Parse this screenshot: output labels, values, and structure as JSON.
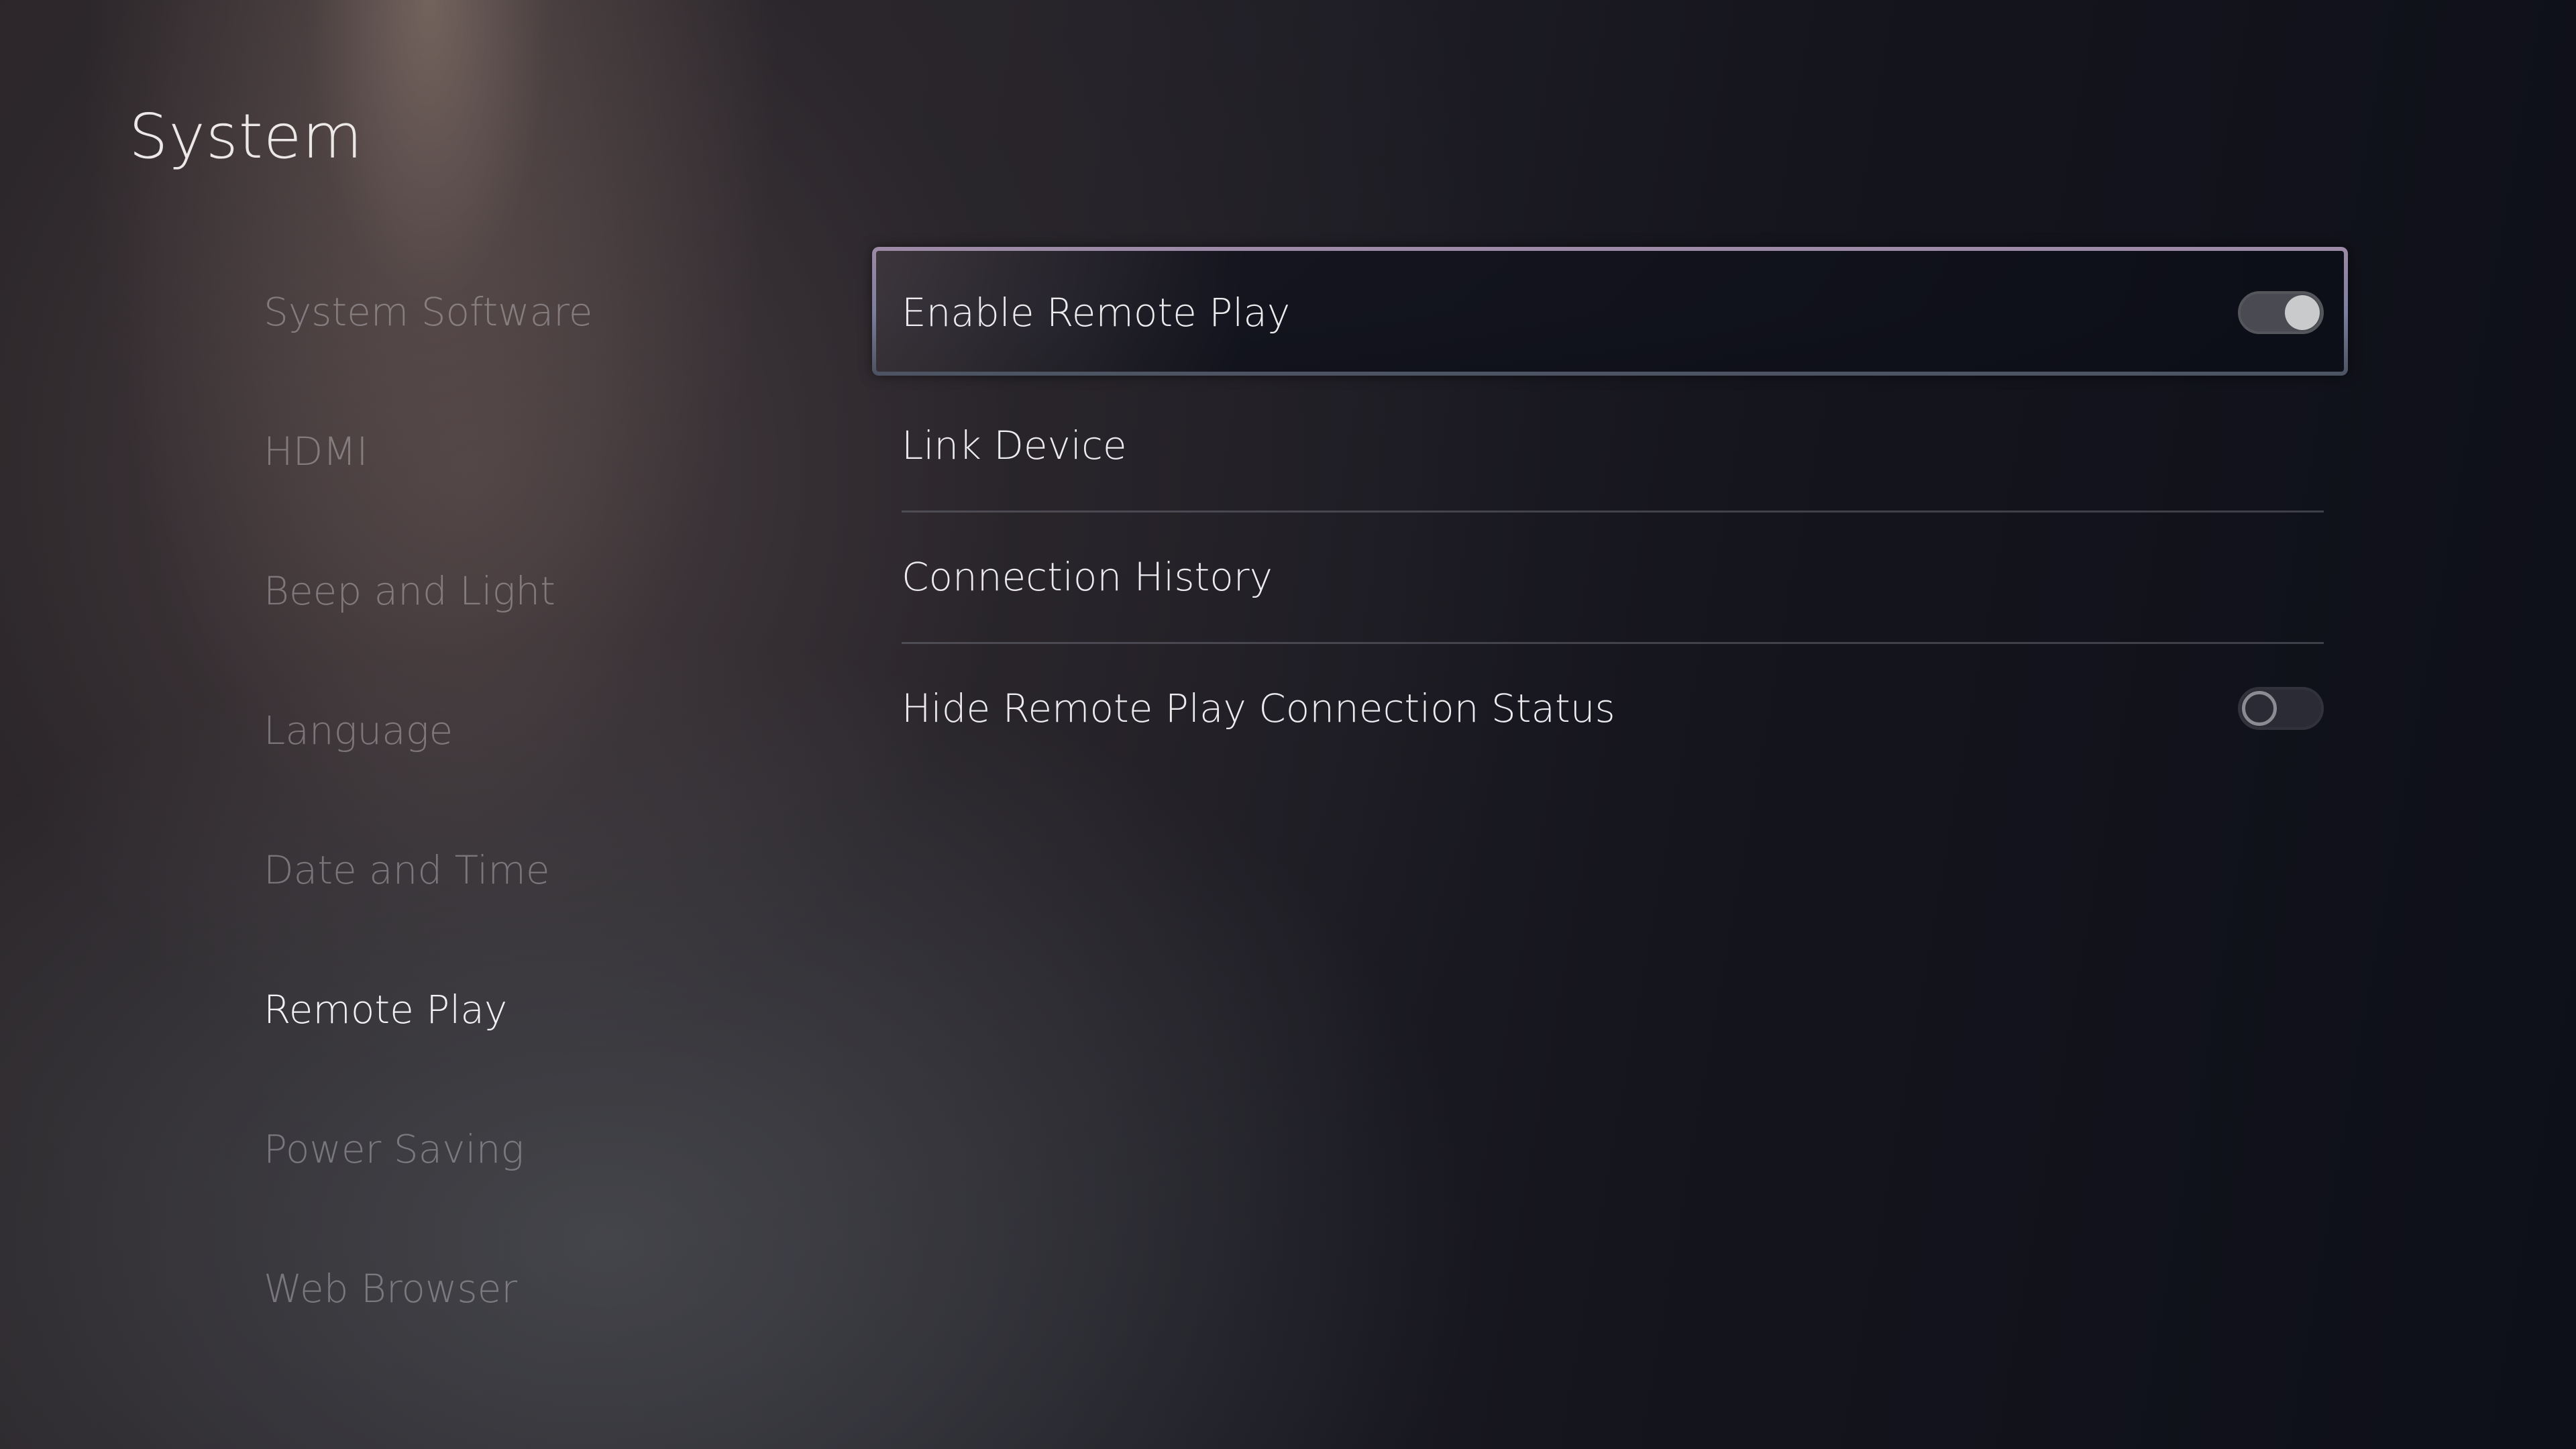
{
  "header": {
    "title": "System"
  },
  "sidebar": {
    "items": [
      {
        "label": "System Software",
        "active": false
      },
      {
        "label": "HDMI",
        "active": false
      },
      {
        "label": "Beep and Light",
        "active": false
      },
      {
        "label": "Language",
        "active": false
      },
      {
        "label": "Date and Time",
        "active": false
      },
      {
        "label": "Remote Play",
        "active": true
      },
      {
        "label": "Power Saving",
        "active": false
      },
      {
        "label": "Web Browser",
        "active": false
      }
    ]
  },
  "main": {
    "settings": [
      {
        "label": "Enable Remote Play",
        "control": "toggle",
        "value": "on",
        "focused": true
      },
      {
        "label": "Link Device",
        "control": "none"
      },
      {
        "label": "Connection History",
        "control": "none"
      },
      {
        "label": "Hide Remote Play Connection Status",
        "control": "toggle",
        "value": "off"
      }
    ]
  },
  "colors": {
    "focus_border": "#9d8aa6",
    "text_active": "#f2f0f2",
    "text_inactive": "#7b777c",
    "toggle_on_knob": "#c9cacb",
    "toggle_off_ring": "#8b8b94"
  }
}
